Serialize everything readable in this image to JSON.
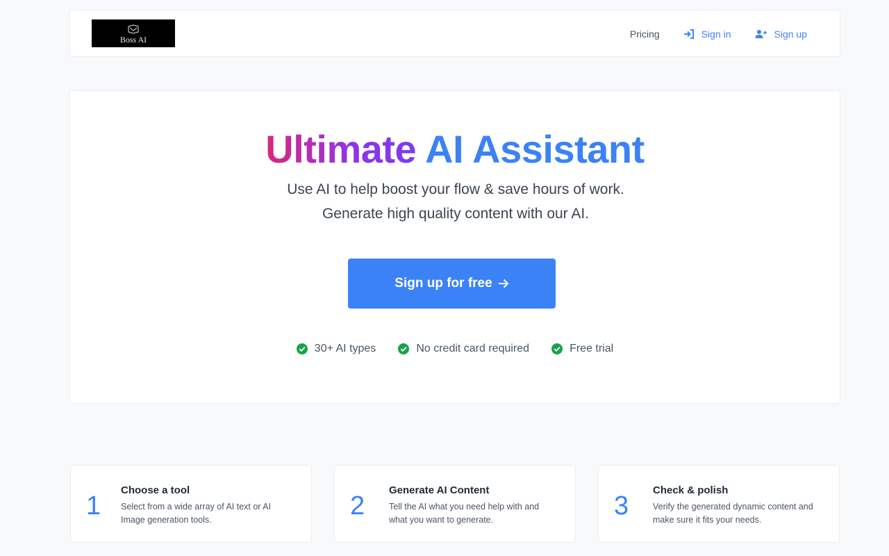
{
  "nav": {
    "logo_text": "Boss AI",
    "pricing": "Pricing",
    "signin": "Sign in",
    "signup": "Sign up"
  },
  "hero": {
    "title_part1": "Ultimate",
    "title_part2": "AI Assistant",
    "subtitle": "Use AI to help boost your flow & save hours of work. Generate high quality content with our AI.",
    "cta": "Sign up for free",
    "features": [
      "30+ AI types",
      "No credit card required",
      "Free trial"
    ]
  },
  "steps": [
    {
      "number": "1",
      "title": "Choose a tool",
      "desc": "Select from a wide array of AI text or AI Image generation tools."
    },
    {
      "number": "2",
      "title": "Generate AI Content",
      "desc": "Tell the AI what you need help with and what you want to generate."
    },
    {
      "number": "3",
      "title": "Check & polish",
      "desc": "Verify the generated dynamic content and make sure it fits your needs."
    }
  ],
  "colors": {
    "accent": "#3b82f6",
    "check": "#16a34a",
    "gradient_start": "#db2777",
    "gradient_end": "#7c3aed"
  },
  "icons": [
    "sign-in-icon",
    "user-plus-icon",
    "arrow-right-icon",
    "check-circle-icon"
  ]
}
